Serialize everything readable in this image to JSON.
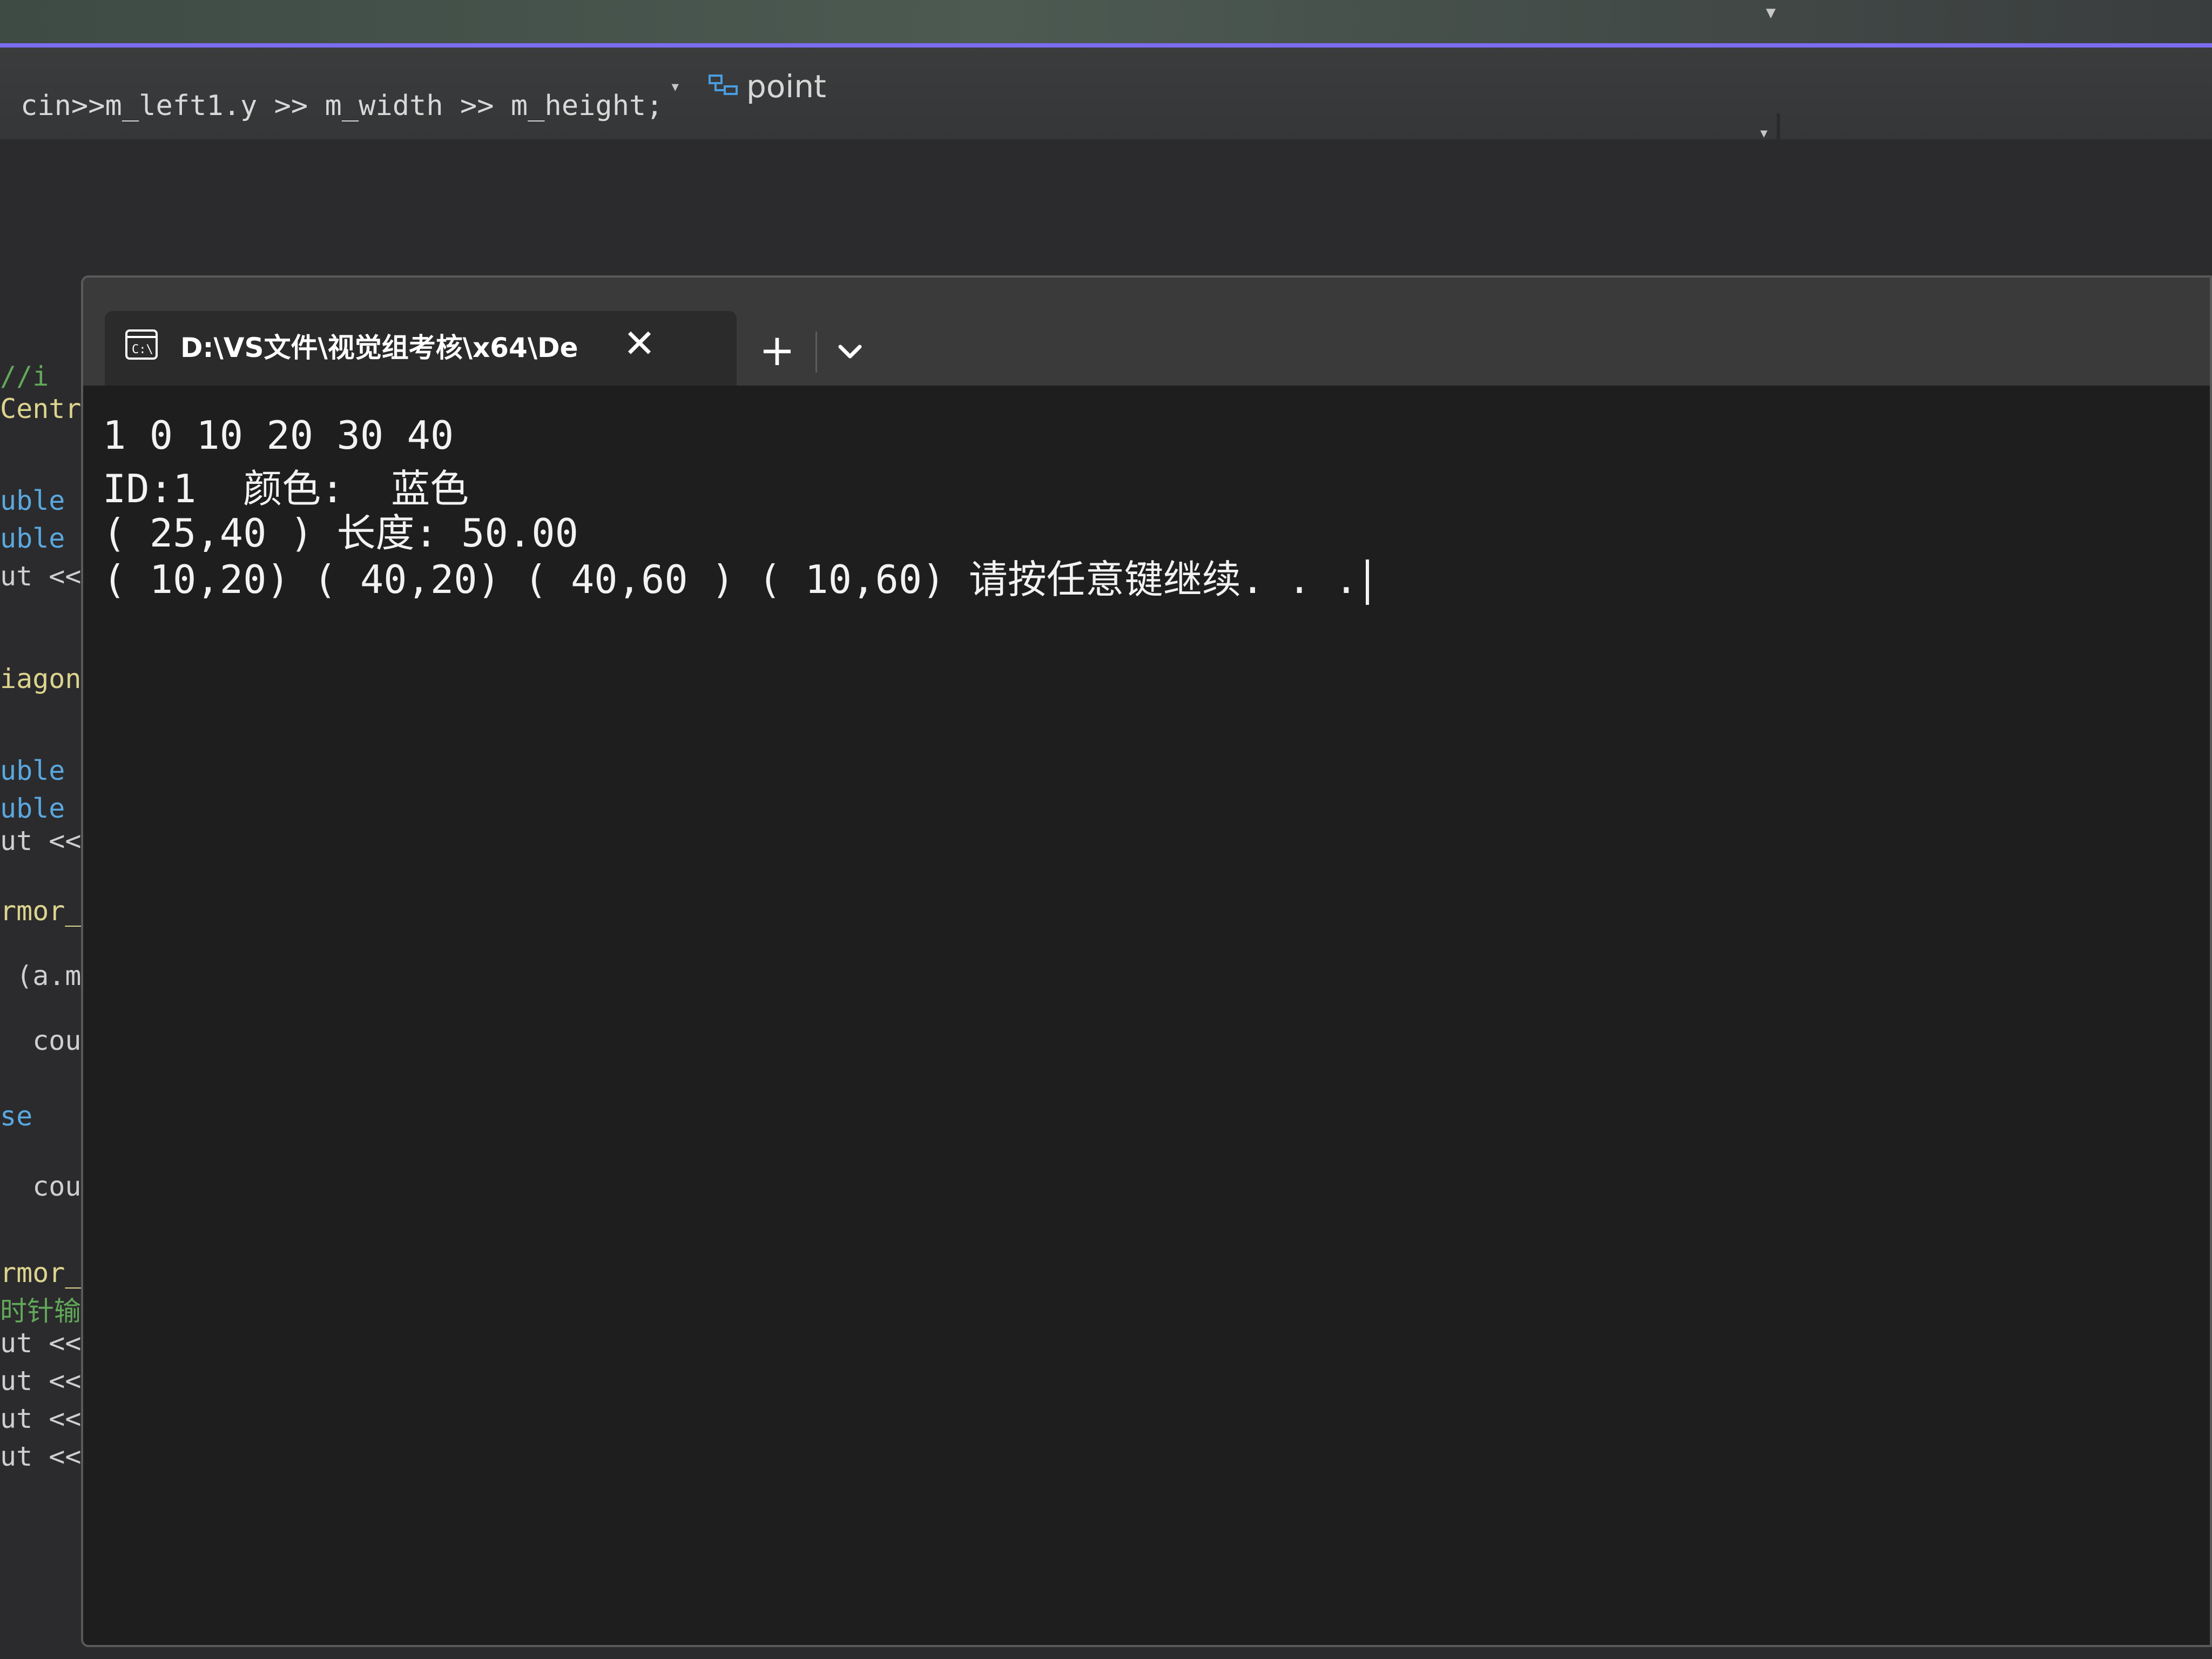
{
  "ide": {
    "code_top_line": "cin>>m_left1.y >> m_width >> m_height;",
    "navbar": {
      "symbol_label": "point"
    },
    "left_code_fragments": [
      {
        "text": "//i",
        "kind": "comment"
      },
      {
        "text": "Centra",
        "kind": "fn"
      },
      {
        "text": "uble l",
        "kind": "type"
      },
      {
        "text": "uble r",
        "kind": "type"
      },
      {
        "text": "ut <<",
        "kind": "plain"
      },
      {
        "text": "iagona",
        "kind": "fn"
      },
      {
        "text": "uble r",
        "kind": "type"
      },
      {
        "text": "uble",
        "kind": "type"
      },
      {
        "text": "ut <<",
        "kind": "plain"
      },
      {
        "text": "rmor_C",
        "kind": "fn"
      },
      {
        "text": " (a.m_",
        "kind": "plain"
      },
      {
        "text": "  cout",
        "kind": "plain"
      },
      {
        "text": "se",
        "kind": "type"
      },
      {
        "text": "  cout",
        "kind": "plain"
      },
      {
        "text": "rmor_P",
        "kind": "fn"
      },
      {
        "text": "时针输出",
        "kind": "comment"
      },
      {
        "text": "ut <<",
        "kind": "plain"
      },
      {
        "text": "ut <<",
        "kind": "plain"
      },
      {
        "text": "ut <<",
        "kind": "plain"
      },
      {
        "text": "ut <<",
        "kind": "plain"
      }
    ]
  },
  "console": {
    "tab_title": "D:\\VS文件\\视觉组考核\\x64\\De",
    "new_tab_symbol": "+",
    "close_symbol": "✕",
    "output_lines": [
      "1 0 10 20 30 40",
      "ID:1  颜色:  蓝色",
      "( 25,40 ) 长度: 50.00",
      "( 10,20) ( 40,20) ( 40,60 ) ( 10,60) 请按任意键继续. . ."
    ]
  },
  "colors": {
    "ide_accent": "#7c6cf0",
    "console_bg": "#1e1e1e",
    "console_text": "#f2f2f2"
  }
}
